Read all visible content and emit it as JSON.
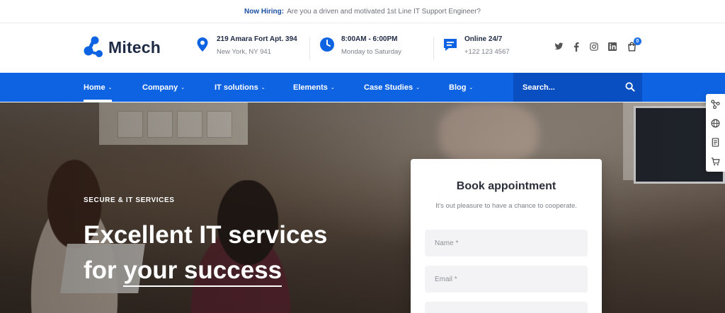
{
  "topbar": {
    "highlight": "Now Hiring:",
    "text": "Are you a driven and motivated 1st Line IT Support Engineer?"
  },
  "brand": {
    "name": "Mitech",
    "accent": "#0e63e3"
  },
  "header_info": {
    "address": {
      "line1": "219 Amara Fort Apt. 394",
      "line2": "New York, NY 941",
      "icon": "map-pin-icon"
    },
    "hours": {
      "line1": "8:00AM - 6:00PM",
      "line2": "Monday to Saturday",
      "icon": "clock-icon"
    },
    "support": {
      "line1": "Online 24/7",
      "line2": "+122 123 4567",
      "icon": "chat-icon"
    }
  },
  "social": {
    "icons": [
      "twitter-icon",
      "facebook-icon",
      "instagram-icon",
      "linkedin-icon"
    ],
    "cart_count": "0"
  },
  "nav": {
    "items": [
      {
        "label": "Home",
        "active": true
      },
      {
        "label": "Company"
      },
      {
        "label": "IT solutions"
      },
      {
        "label": "Elements"
      },
      {
        "label": "Case Studies"
      },
      {
        "label": "Blog"
      }
    ],
    "search_placeholder": "Search..."
  },
  "hero": {
    "eyebrow": "SECURE & IT SERVICES",
    "headline_line1": "Excellent IT services",
    "headline_line2_prefix": "for ",
    "headline_line2_underlined": "your success"
  },
  "appointment": {
    "title": "Book appointment",
    "subtitle": "It's out pleasure to have a chance to cooperate.",
    "name_placeholder": "Name *",
    "email_placeholder": "Email *"
  },
  "side_panel": {
    "icons": [
      "layout-tree-icon",
      "globe-icon",
      "document-icon",
      "cart-icon"
    ]
  }
}
